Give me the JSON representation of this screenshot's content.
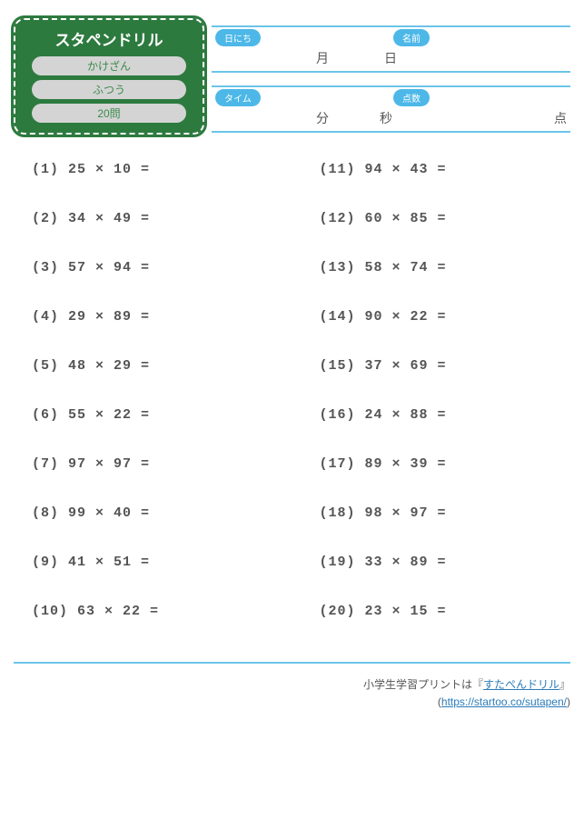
{
  "titleBox": {
    "title": "スタペンドリル",
    "pill1": "かけざん",
    "pill2": "ふつう",
    "pill3": "20問"
  },
  "info": {
    "row1": {
      "badgeLeft": "日にち",
      "badgeRight": "名前",
      "text1": "月",
      "text2": "日"
    },
    "row2": {
      "badgeLeft": "タイム",
      "badgeRight": "点数",
      "text1": "分",
      "text2": "秒",
      "text3": "点"
    }
  },
  "problemsLeft": [
    "(1) 25 × 10 =",
    "(2) 34 × 49 =",
    "(3) 57 × 94 =",
    "(4) 29 × 89 =",
    "(5) 48 × 29 =",
    "(6) 55 × 22 =",
    "(7) 97 × 97 =",
    "(8) 99 × 40 =",
    "(9) 41 × 51 =",
    "(10) 63 × 22 ="
  ],
  "problemsRight": [
    "(11) 94 × 43 =",
    "(12) 60 × 85 =",
    "(13) 58 × 74 =",
    "(14) 90 × 22 =",
    "(15) 37 × 69 =",
    "(16) 24 × 88 =",
    "(17) 89 × 39 =",
    "(18) 98 × 97 =",
    "(19) 33 × 89 =",
    "(20) 23 × 15 ="
  ],
  "footer": {
    "text1": "小学生学習プリントは『",
    "link1": "すたぺんドリル",
    "text2": "』",
    "text3": "(",
    "link2": "https://startoo.co/sutapen/",
    "text4": ")"
  }
}
